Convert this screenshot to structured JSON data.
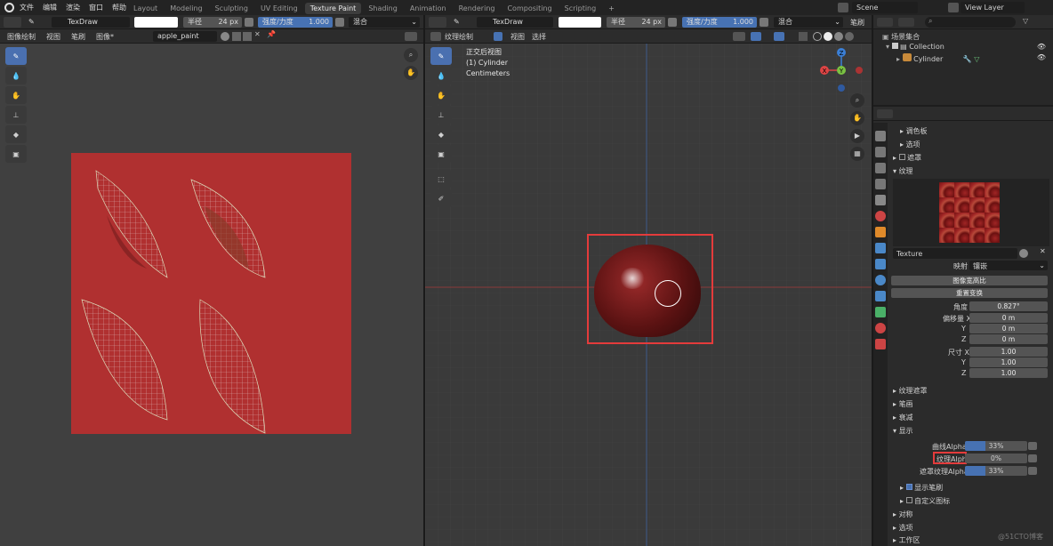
{
  "menu": [
    "文件",
    "编辑",
    "渲染",
    "窗口",
    "帮助"
  ],
  "workspaces": [
    {
      "label": "Layout"
    },
    {
      "label": "Modeling"
    },
    {
      "label": "Sculpting"
    },
    {
      "label": "UV Editing"
    },
    {
      "label": "Texture Paint",
      "active": true
    },
    {
      "label": "Shading"
    },
    {
      "label": "Animation"
    },
    {
      "label": "Rendering"
    },
    {
      "label": "Compositing"
    },
    {
      "label": "Scripting"
    }
  ],
  "scene": "Scene",
  "view_layer": "View Layer",
  "left_tool": {
    "brush": "TexDraw",
    "radius_label": "半径",
    "radius_value": "24 px",
    "strength_label": "强度/力度",
    "strength_value": "1.000",
    "blend": "混合"
  },
  "left_menu": {
    "mode": "图像绘制",
    "view": "视图",
    "brush": "笔刷",
    "image": "图像*",
    "image_name": "apple_paint"
  },
  "right_tool": {
    "brush": "TexDraw",
    "radius_label": "半径",
    "radius_value": "24 px",
    "strength_label": "强度/力度",
    "strength_value": "1.000",
    "blend": "混合",
    "brush_menu": "笔刷"
  },
  "right_menu": {
    "mode": "纹理绘制",
    "view": "视图",
    "select": "选择"
  },
  "viewport": {
    "line1": "正交后视图",
    "line2": "(1) Cylinder",
    "line3": "Centimeters"
  },
  "gizmo": {
    "x": "X",
    "y": "Y",
    "z": "Z"
  },
  "outliner": {
    "root": "场景集合",
    "collection": "Collection",
    "object": "Cylinder"
  },
  "props": {
    "palette": "调色板",
    "options": "选项",
    "mask": "遮罩",
    "texture_sec": "纹理",
    "texture_name": "Texture",
    "mapping_label": "映射",
    "mapping_value": "镶嵌",
    "btn_aspect": "图像宽高比",
    "btn_reset": "重置变换",
    "angle_label": "角度",
    "angle_value": "0.827°",
    "offx_label": "偏移量 X",
    "offx": "0 m",
    "offy_label": "Y",
    "offy": "0 m",
    "offz_label": "Z",
    "offz": "0 m",
    "sizex_label": "尺寸 X",
    "sizex": "1.00",
    "sizey_label": "Y",
    "sizey": "1.00",
    "sizez_label": "Z",
    "sizez": "1.00",
    "tex_mask": "纹理遮罩",
    "stroke": "笔画",
    "falloff": "衰减",
    "display": "显示",
    "curve_alpha_label": "曲线Alpha",
    "curve_alpha": "33%",
    "tex_alpha_label": "纹理Alpha",
    "tex_alpha": "0%",
    "mask_alpha_label": "遮罩纹理Alpha",
    "mask_alpha": "33%",
    "show_brush": "显示笔刷",
    "custom_icon": "自定义图标",
    "symmetry": "对称",
    "options2": "选项",
    "workspace": "工作区"
  },
  "watermark": "@51CTO博客"
}
